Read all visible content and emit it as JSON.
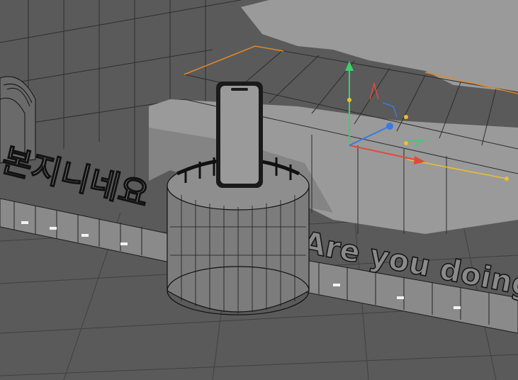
{
  "viewport": {
    "projection": "perspective",
    "shading": "wireframe",
    "background_color": "#5a5a5a",
    "grid_color": "#3a3a3a",
    "wall_color": "#9a9a9a"
  },
  "scene": {
    "objects": [
      {
        "name": "phone",
        "kind": "mesh"
      },
      {
        "name": "round-stand",
        "kind": "mesh"
      },
      {
        "name": "conveyor-belt",
        "kind": "mesh"
      },
      {
        "name": "arch",
        "kind": "mesh"
      },
      {
        "name": "back-wall-box",
        "kind": "mesh",
        "selected": true
      }
    ],
    "text_3d": {
      "korean": "본지니네요",
      "english": "Are you doing"
    }
  },
  "gizmo": {
    "mode": "move",
    "axes": [
      {
        "axis": "x",
        "color": "#e04a3a"
      },
      {
        "axis": "y",
        "color": "#3ad06a"
      },
      {
        "axis": "z",
        "color": "#3a7ae0"
      }
    ],
    "selection_outline_color": "#e08a2a",
    "pivot_line_color": "#e8c030"
  }
}
